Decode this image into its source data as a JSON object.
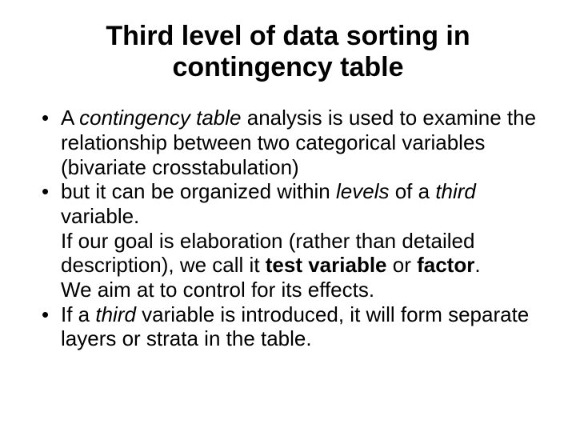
{
  "title": "Third level of data sorting in contingency table",
  "bullets": [
    {
      "pre": "A ",
      "em1": "contingency table",
      "post1": " analysis is used to examine the relationship between two categorical variables (bivariate crosstabulation)"
    },
    {
      "pre": "but it can be organized within ",
      "em1": "levels",
      "mid1": " of a ",
      "em2": "third",
      "post1": " variable.",
      "line2a": "If our goal is elaboration (rather than detailed description), we call it ",
      "b1": "test variable",
      "mid2": " or ",
      "b2": "factor",
      "post2": ".",
      "line3": "We aim at to control for its effects."
    },
    {
      "pre": "If a ",
      "em1": "third",
      "post1": " variable is introduced, it will form separate layers or strata in the table."
    }
  ]
}
